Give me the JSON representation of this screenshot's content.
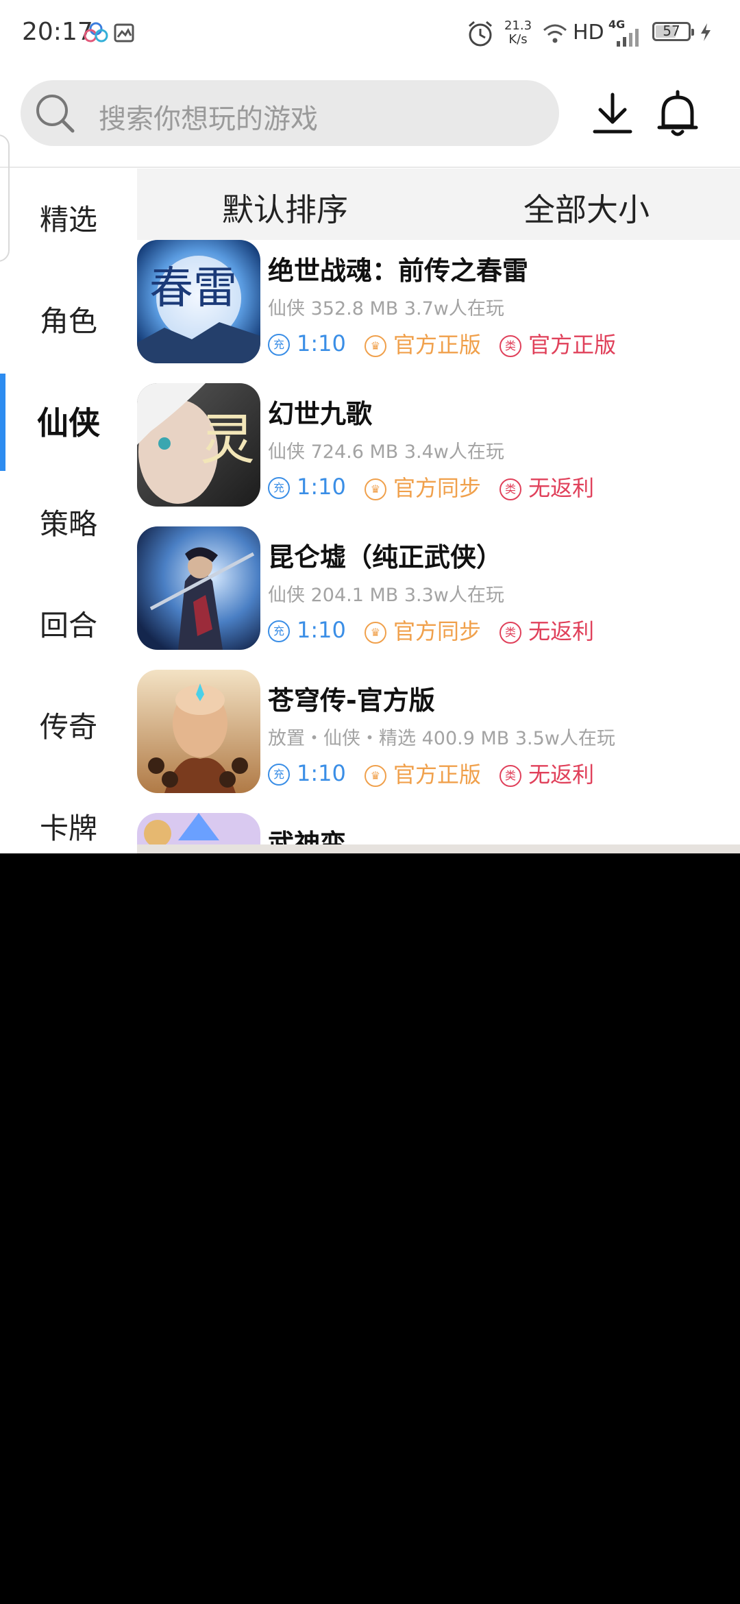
{
  "status_bar": {
    "time": "20:17",
    "net_speed_value": "21.3",
    "net_speed_unit": "K/s",
    "hd": "HD",
    "network": "4G",
    "battery": "57"
  },
  "search": {
    "placeholder": "搜索你想玩的游戏"
  },
  "categories": [
    {
      "label": "精选"
    },
    {
      "label": "角色"
    },
    {
      "label": "仙侠"
    },
    {
      "label": "策略"
    },
    {
      "label": "回合"
    },
    {
      "label": "传奇"
    },
    {
      "label": "卡牌"
    }
  ],
  "active_category": "仙侠",
  "sort": {
    "order": "默认排序",
    "size": "全部大小"
  },
  "games": [
    {
      "title": "绝世战魂：前传之春雷",
      "meta": "仙侠  352.8 MB  3.7w人在玩",
      "icon_text": "春雷",
      "tags": [
        {
          "icon": "充",
          "text": "1:10",
          "color": "#3a8ee6"
        },
        {
          "icon": "crown-icon",
          "text": "官方正版",
          "color": "#f0a04b"
        },
        {
          "icon": "类",
          "text": "官方正版",
          "color": "#e0405a"
        }
      ]
    },
    {
      "title": "幻世九歌",
      "meta": "仙侠  724.6 MB  3.4w人在玩",
      "icon_text": "灵",
      "tags": [
        {
          "icon": "充",
          "text": "1:10",
          "color": "#3a8ee6"
        },
        {
          "icon": "crown-icon",
          "text": "官方同步",
          "color": "#f0a04b"
        },
        {
          "icon": "类",
          "text": "无返利",
          "color": "#e0405a"
        }
      ]
    },
    {
      "title": "昆仑墟（纯正武侠）",
      "meta": "仙侠  204.1 MB  3.3w人在玩",
      "icon_text": "",
      "tags": [
        {
          "icon": "充",
          "text": "1:10",
          "color": "#3a8ee6"
        },
        {
          "icon": "crown-icon",
          "text": "官方同步",
          "color": "#f0a04b"
        },
        {
          "icon": "类",
          "text": "无返利",
          "color": "#e0405a"
        }
      ]
    },
    {
      "title": "苍穹传-官方版",
      "meta": "放置・仙侠・精选  400.9 MB  3.5w人在玩",
      "icon_text": "",
      "tags": [
        {
          "icon": "充",
          "text": "1:10",
          "color": "#3a8ee6"
        },
        {
          "icon": "crown-icon",
          "text": "官方正版",
          "color": "#f0a04b"
        },
        {
          "icon": "类",
          "text": "无返利",
          "color": "#e0405a"
        }
      ]
    },
    {
      "title": "武神变",
      "meta": "",
      "icon_text": "",
      "tags": []
    }
  ]
}
